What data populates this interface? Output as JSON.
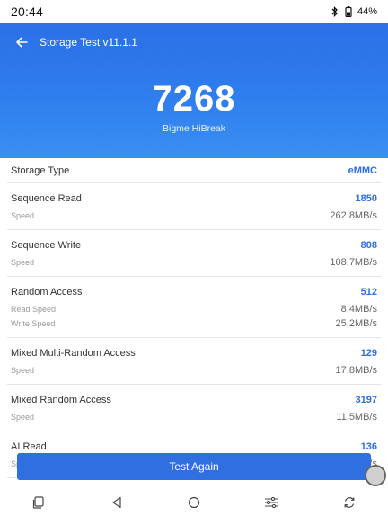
{
  "status": {
    "time": "20:44",
    "battery": "44%",
    "icons": [
      "bluetooth-icon",
      "battery-icon"
    ]
  },
  "header": {
    "title": "Storage Test v11.1.1",
    "score": "7268",
    "device": "Bigme HiBreak",
    "color_top": "#2b6fe6",
    "color_bottom": "#3a8ff2"
  },
  "results": {
    "storage_type": {
      "label": "Storage Type",
      "value": "eMMC"
    },
    "sequence_read": {
      "label": "Sequence Read",
      "score": "1850",
      "sub": [
        {
          "label": "Speed",
          "value": "262.8MB/s"
        }
      ]
    },
    "sequence_write": {
      "label": "Sequence Write",
      "score": "808",
      "sub": [
        {
          "label": "Speed",
          "value": "108.7MB/s"
        }
      ]
    },
    "random_access": {
      "label": "Random Access",
      "score": "512",
      "sub": [
        {
          "label": "Read Speed",
          "value": "8.4MB/s"
        },
        {
          "label": "Write Speed",
          "value": "25.2MB/s"
        }
      ]
    },
    "mixed_multi_random": {
      "label": "Mixed Multi-Random Access",
      "score": "129",
      "sub": [
        {
          "label": "Speed",
          "value": "17.8MB/s"
        }
      ]
    },
    "mixed_random": {
      "label": "Mixed Random Access",
      "score": "3197",
      "sub": [
        {
          "label": "Speed",
          "value": "11.5MB/s"
        }
      ]
    },
    "ai_read": {
      "label": "AI Read",
      "score": "136",
      "sub": [
        {
          "label": "Speed",
          "value": "8.4MB/s"
        }
      ]
    }
  },
  "actions": {
    "test_again": "Test Again"
  },
  "navbar": {
    "items": [
      "recents-icon",
      "back-triangle-icon",
      "home-circle-icon",
      "settings-sliders-icon",
      "rotate-icon"
    ]
  },
  "colors": {
    "accent": "#2f6fdf"
  }
}
